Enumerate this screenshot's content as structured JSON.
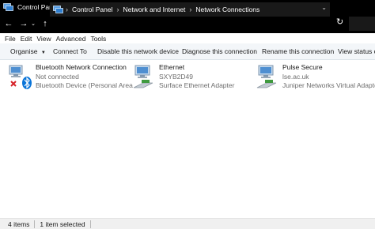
{
  "window": {
    "title": "Control Panel\\Network and Internet\\Network Connections"
  },
  "address": {
    "crumbs": [
      "Control Panel",
      "Network and Internet",
      "Network Connections"
    ]
  },
  "menu": [
    "File",
    "Edit",
    "View",
    "Advanced",
    "Tools"
  ],
  "commands": {
    "organise": "Organise",
    "connect_to": "Connect To",
    "disable": "Disable this network device",
    "diagnose": "Diagnose this connection",
    "rename": "Rename this connection",
    "view_status": "View status of"
  },
  "connections": [
    {
      "name": "Bluetooth Network Connection",
      "status": "Not connected",
      "adapter": "Bluetooth Device (Personal Area ...",
      "icon": "bluetooth-network-icon"
    },
    {
      "name": "Ethernet",
      "status": "SXYB2D49",
      "adapter": "Surface Ethernet Adapter",
      "icon": "ethernet-network-icon"
    },
    {
      "name": "Pulse Secure",
      "status": "lse.ac.uk",
      "adapter": "Juniper Networks Virtual Adapter",
      "icon": "vpn-network-icon"
    }
  ],
  "statusbar": {
    "count": "4 items",
    "selected": "1 item selected"
  },
  "colors": {
    "titlebar_bg": "#000000",
    "cmdbar_bg": "#f3f6f9",
    "bluetooth_blue": "#0a74d8",
    "error_red": "#d6232a"
  }
}
